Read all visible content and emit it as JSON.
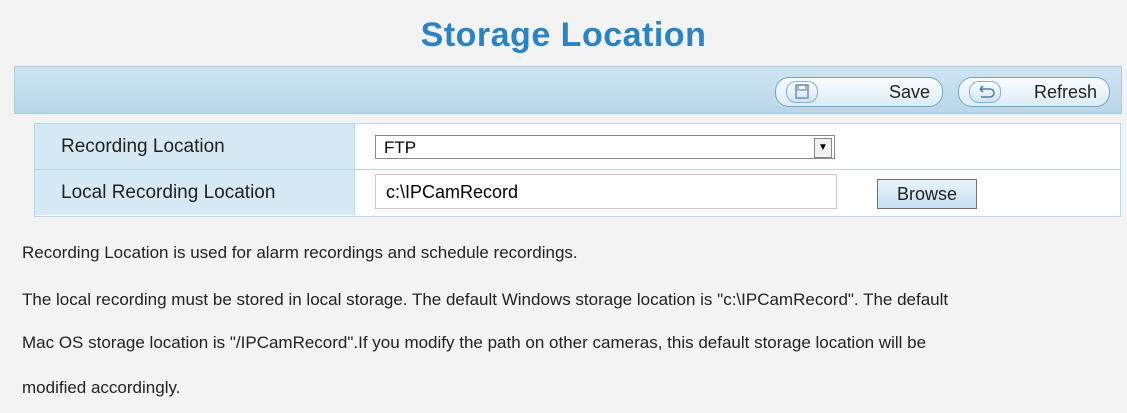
{
  "page": {
    "title": "Storage Location"
  },
  "toolbar": {
    "save_label": "Save",
    "refresh_label": "Refresh"
  },
  "form": {
    "recording_location": {
      "label": "Recording Location",
      "selected": "FTP"
    },
    "local_recording_location": {
      "label": "Local Recording Location",
      "value": "c:\\IPCamRecord",
      "browse_label": "Browse"
    }
  },
  "description": {
    "line1": "Recording Location is used for alarm recordings and schedule recordings.",
    "line2": "The local recording must be stored in local storage. The default Windows storage location is \"c:\\IPCamRecord\". The default",
    "line3": "Mac OS storage location is \"/IPCamRecord\".If you modify the path on other cameras, this default storage location will be",
    "line4": "modified accordingly."
  },
  "colors": {
    "title": "#2a83c4",
    "toolbar": "#c4e0f0",
    "label_cell": "#d6e9f5"
  },
  "icons": {
    "save": "floppy-disk-icon",
    "refresh": "refresh-arrow-icon",
    "dropdown": "chevron-down-icon"
  }
}
